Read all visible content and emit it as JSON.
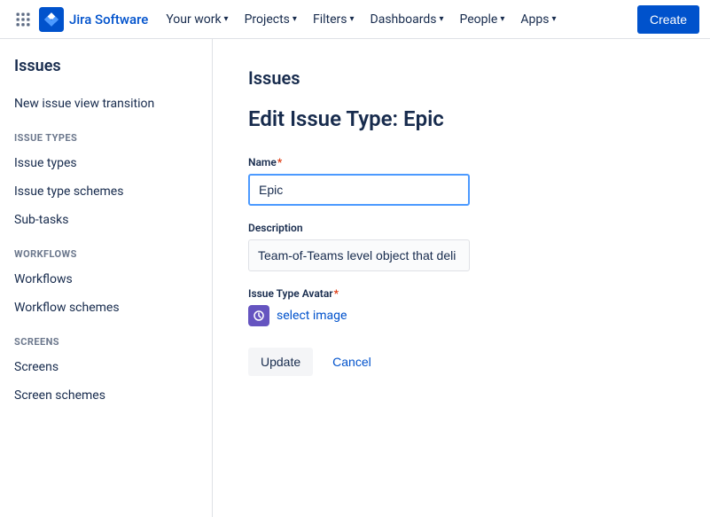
{
  "topnav": {
    "logo_text": "Jira Software",
    "your_work": "Your work",
    "projects": "Projects",
    "filters": "Filters",
    "dashboards": "Dashboards",
    "people": "People",
    "apps": "Apps",
    "create": "Create"
  },
  "sidebar": {
    "header": "Issues",
    "link_new_issue": "New issue view transition",
    "section_issue_types": "ISSUE TYPES",
    "link_issue_types": "Issue types",
    "link_issue_type_schemes": "Issue type schemes",
    "link_subtasks": "Sub-tasks",
    "section_workflows": "WORKFLOWS",
    "link_workflows": "Workflows",
    "link_workflow_schemes": "Workflow schemes",
    "section_screens": "SCREENS",
    "link_screens": "Screens",
    "link_screen_schemes": "Screen schemes"
  },
  "main": {
    "title": "Issues",
    "subtitle": "Edit Issue Type: Epic",
    "label_name": "Name",
    "label_description": "Description",
    "label_avatar": "Issue Type Avatar",
    "name_value": "Epic",
    "description_value": "Team-of-Teams level object that deli",
    "select_image": "select image",
    "btn_update": "Update",
    "btn_cancel": "Cancel"
  }
}
